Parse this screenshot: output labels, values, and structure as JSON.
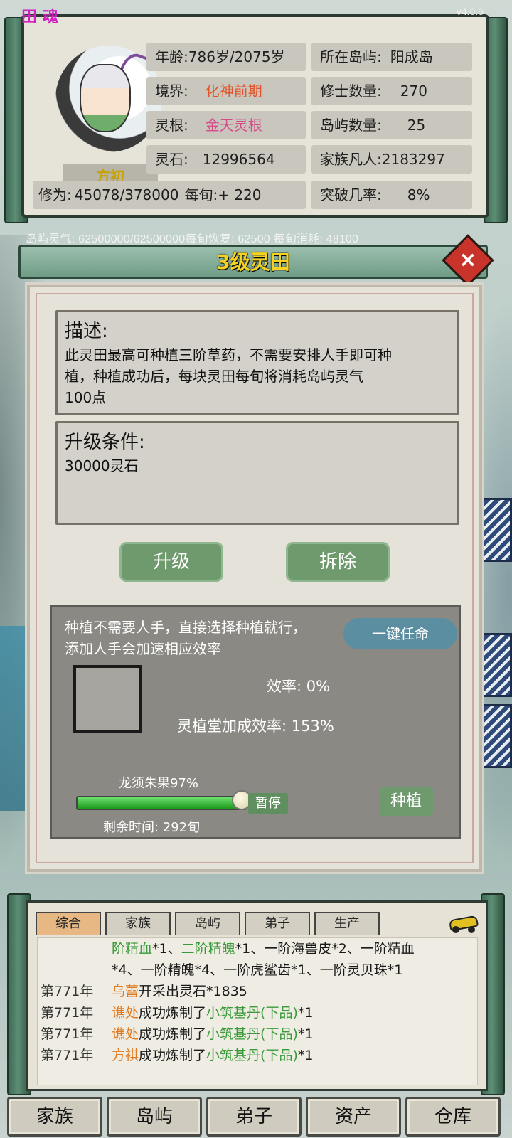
{
  "app": {
    "version": "v4.0.6",
    "logo_text": "田 魂"
  },
  "profile": {
    "name": "方初",
    "age_label": "年龄:",
    "age_value": "786岁/2075岁",
    "realm_label": "境界:",
    "realm_value": "化神前期",
    "root_label": "灵根:",
    "root_value": "金天灵根",
    "stone_label": "灵石:",
    "stone_value": "12996564",
    "cultivation_label": "修为:",
    "cultivation_value": "45078/378000",
    "per_turn": "每旬:+ 220",
    "island_label": "所在岛屿:",
    "island_value": "阳成岛",
    "cultivators_label": "修士数量:",
    "cultivators_value": "270",
    "islands_label": "岛屿数量:",
    "islands_value": "25",
    "mortals_label": "家族凡人:",
    "mortals_value": "2183297",
    "breakthrough_label": "突破几率:",
    "breakthrough_value": "8%"
  },
  "qi_line": "岛屿灵气: 62500000/62500000每旬恢复: 62500 每旬消耗: 48100",
  "dialog": {
    "title": "3级灵田",
    "close_icon": "×",
    "desc_title": "描述:",
    "desc_text_1": "此灵田最高可种植三阶草药，不需要安排人手即可种",
    "desc_text_2": "植，种植成功后，每块灵田每旬将消耗岛屿灵气",
    "desc_text_3": "100点",
    "upgrade_title": "升级条件:",
    "upgrade_text": "30000灵石",
    "upgrade_button": "升级",
    "demolish_button": "拆除"
  },
  "planting": {
    "info_1": "种植不需要人手，直接选择种植就行，",
    "info_2": "添加人手会加速相应效率",
    "appoint_button": "一键任命",
    "efficiency": "效率: 0%",
    "hall_bonus": "灵植堂加成效率: 153%",
    "crop_label": "龙须朱果97%",
    "progress": 0.97,
    "pause_button": "暂停",
    "plant_button": "种植",
    "remaining": "剩余时间: 292旬"
  },
  "log": {
    "tabs": [
      "综合",
      "家族",
      "岛屿",
      "弟子",
      "生产"
    ],
    "active_tab": 0,
    "line_0_a": "阶精血",
    "line_0_b": "*1、",
    "line_0_c": "二阶精魄",
    "line_0_d": "*1、一阶海兽皮*2、一阶精血",
    "line_1": "*4、一阶精魄*4、一阶虎鲨齿*1、一阶灵贝珠*1",
    "entries": [
      {
        "year": "第771年",
        "who": "乌蕾",
        "action": "开采出灵石*1835",
        "item": "",
        "tail": ""
      },
      {
        "year": "第771年",
        "who": "谯处",
        "action": "成功炼制了",
        "item": "小筑基丹(下品)",
        "tail": "*1"
      },
      {
        "year": "第771年",
        "who": "谯处",
        "action": "成功炼制了",
        "item": "小筑基丹(下品)",
        "tail": "*1"
      },
      {
        "year": "第771年",
        "who": "方祺",
        "action": "成功炼制了",
        "item": "小筑基丹(下品)",
        "tail": "*1"
      }
    ]
  },
  "bottom_nav": [
    "家族",
    "岛屿",
    "弟子",
    "资产",
    "仓库"
  ],
  "colors": {
    "accent_gold": "#f4d21f",
    "green_button": "#6e9a6e",
    "red_text": "#e2552a",
    "pink_text": "#d64a8a",
    "log_green": "#3a9a3a",
    "log_orange": "#e07a1e"
  }
}
